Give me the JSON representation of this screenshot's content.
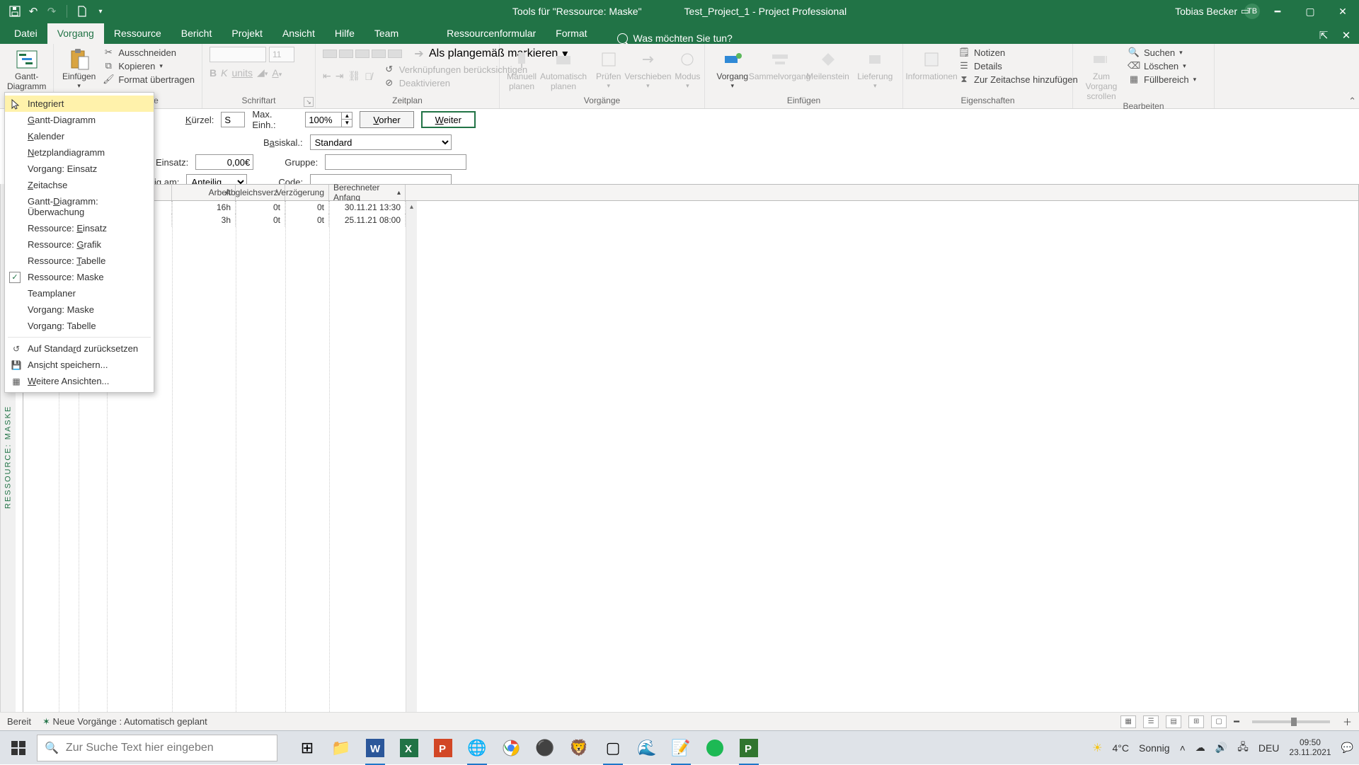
{
  "titlebar": {
    "tools_label": "Tools für \"Ressource: Maske\"",
    "doc_label": "Test_Project_1  -  Project Professional",
    "user_name": "Tobias Becker",
    "user_initials": "TB"
  },
  "tabs": {
    "file": "Datei",
    "task": "Vorgang",
    "resource": "Ressource",
    "report": "Bericht",
    "project": "Projekt",
    "view": "Ansicht",
    "help": "Hilfe",
    "team": "Team",
    "ctx1": "Ressourcenformular",
    "ctx2": "Format",
    "tellme": "Was möchten Sie tun?"
  },
  "ribbon": {
    "gantt_top": "Gantt-",
    "gantt_bottom": "Diagramm",
    "view_group": "",
    "paste": "Einfügen",
    "cut": "Ausschneiden",
    "copy": "Kopieren",
    "format_painter": "Format übertragen",
    "clipboard_group": "Zwischenablage",
    "font_size": "11",
    "font_group": "Schriftart",
    "mark_ontrack": "Als plangemäß markieren",
    "respect_links": "Verknüpfungen berücksichtigen",
    "deactivate": "Deaktivieren",
    "schedule_group": "Zeitplan",
    "manual": "Manuell planen",
    "auto": "Automatisch planen",
    "inspect": "Prüfen",
    "move": "Verschieben",
    "mode": "Modus",
    "tasks_group": "Vorgänge",
    "task_btn": "Vorgang",
    "summary": "Sammelvorgang",
    "milestone": "Meilenstein",
    "deliverable": "Lieferung",
    "insert_group": "Einfügen",
    "information": "Informationen",
    "notes": "Notizen",
    "details": "Details",
    "add_timeline": "Zur Zeitachse hinzufügen",
    "properties_group": "Eigenschaften",
    "scroll_task_top": "Zum Vorgang",
    "scroll_task_bottom": "scrollen",
    "find": "Suchen",
    "clear": "Löschen",
    "fill": "Füllbereich",
    "editing_group": "Bearbeiten"
  },
  "form": {
    "short_label": "Kürzel:",
    "short_value": "S",
    "maxunits_label": "Max. Einh.:",
    "maxunits_value": "100%",
    "prev": "Vorher",
    "next": "Weiter",
    "basecal_label": "Basiskal.:",
    "basecal_value": "Standard",
    "group_label": "Gruppe:",
    "cost_label": "Einsatz:",
    "cost_value": "0,00€",
    "accrue_label": "ig am:",
    "accrue_value": "Anteilig",
    "code_label": "Code:"
  },
  "grid": {
    "headers": {
      "name": "ne",
      "work": "Arbeit",
      "leveldelay": "Abgleichsverz.",
      "delay": "Verzögerung",
      "schedstart": "Berechneter Anfang"
    },
    "rows": [
      {
        "work": "16h",
        "leveldelay": "0t",
        "delay": "0t",
        "start": "30.11.21 13:30"
      },
      {
        "work": "3h",
        "leveldelay": "0t",
        "delay": "0t",
        "start": "25.11.21 08:00"
      }
    ]
  },
  "viewmenu": {
    "items": [
      "Integriert",
      "Gantt-Diagramm",
      "Kalender",
      "Netzplandiagramm",
      "Vorgang: Einsatz",
      "Zeitachse",
      "Gantt-Diagramm: Überwachung",
      "Ressource: Einsatz",
      "Ressource: Grafik",
      "Ressource: Tabelle",
      "Ressource: Maske",
      "Teamplaner",
      "Vorgang: Maske",
      "Vorgang: Tabelle"
    ],
    "reset": "Auf Standard zurücksetzen",
    "save_view": "Ansicht speichern...",
    "more_views": "Weitere Ansichten..."
  },
  "side_label": "RESSOURCE: MASKE",
  "statusbar": {
    "ready": "Bereit",
    "newtasks_icon": "✶",
    "newtasks": "Neue Vorgänge : Automatisch geplant"
  },
  "taskbar": {
    "search_placeholder": "Zur Suche Text hier eingeben",
    "weather_temp": "4°C",
    "weather_desc": "Sonnig",
    "lang": "DEU",
    "time": "09:50",
    "date": "23.11.2021"
  }
}
